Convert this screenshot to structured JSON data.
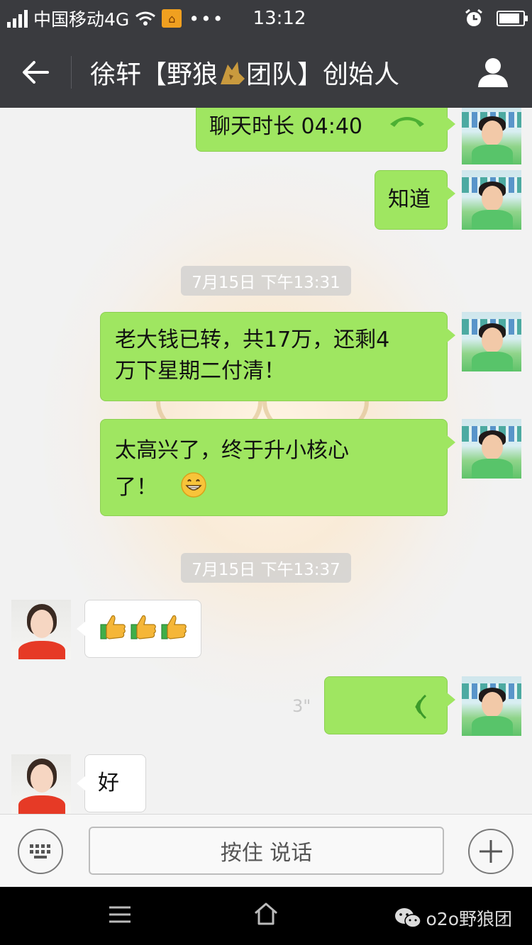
{
  "status_bar": {
    "carrier": "中国移动4G",
    "dots": "•••",
    "time": "13:12"
  },
  "header": {
    "title_before_icon": "徐轩【野狼",
    "title_after_icon": "团队】创始人"
  },
  "messages": {
    "call": {
      "label": "聊天时长 04:40"
    },
    "know": {
      "text": "知道"
    },
    "ts1": {
      "text": "7月15日 下午13:31"
    },
    "money": {
      "line1": "老大钱已转，共17万，还剩4",
      "line2": "万下星期二付清！"
    },
    "happy": {
      "line1": "太高兴了，终于升小核心",
      "line2": "了！"
    },
    "ts2": {
      "text": "7月15日 下午13:37"
    },
    "thumbs": {
      "text": "👍👍👍"
    },
    "voice": {
      "duration": "3\""
    },
    "ok": {
      "text": "好"
    }
  },
  "input": {
    "hold_to_talk_label": "按住 说话"
  },
  "watermark": {
    "text": "o2o野狼团"
  },
  "colors": {
    "header_bg": "#3a3b3f",
    "bubble_me": "#9fe661",
    "bubble_other": "#ffffff",
    "chat_bg": "#f2f2f2"
  }
}
